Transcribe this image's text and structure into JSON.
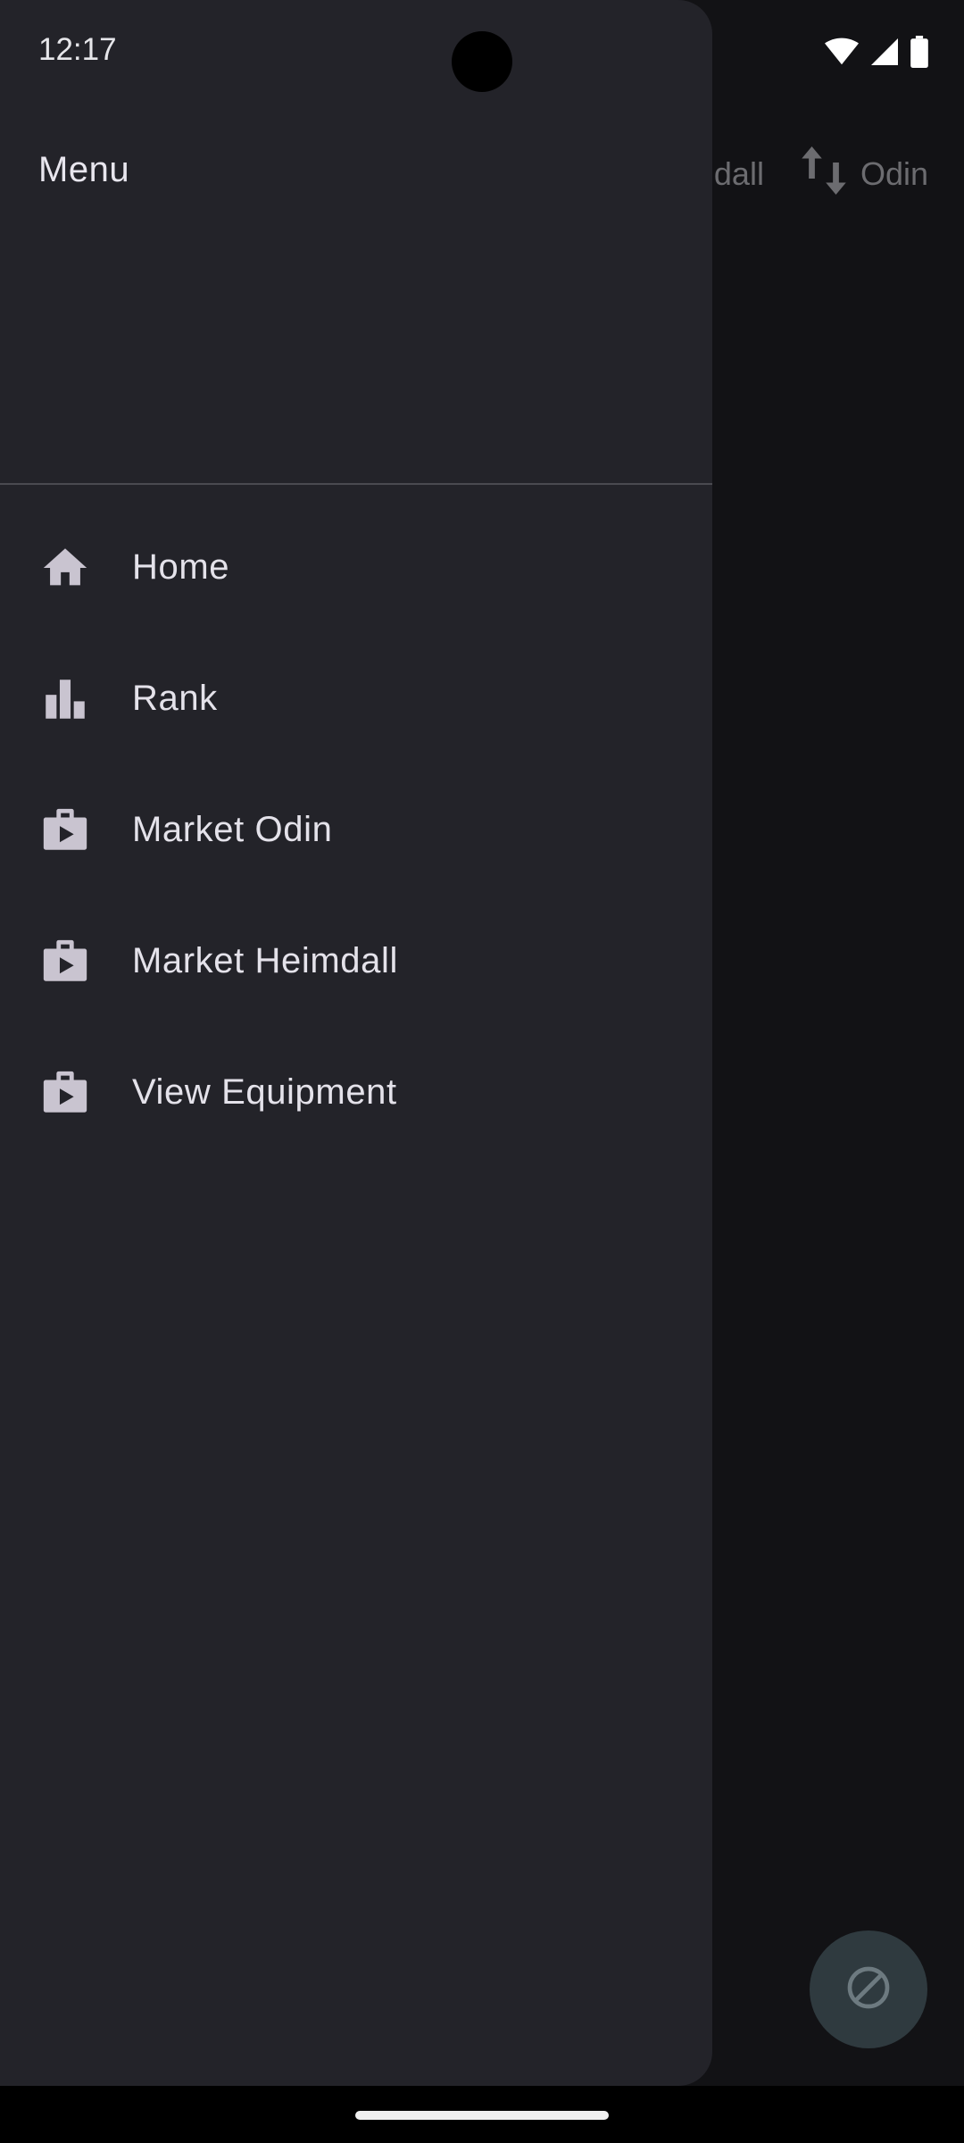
{
  "status_bar": {
    "time": "12:17",
    "icons": [
      "wifi-icon",
      "signal-icon",
      "battery-icon"
    ]
  },
  "background_app": {
    "toolbar": {
      "action_partial_label": "dall",
      "swap_label": "Odin"
    },
    "fab_icon": "block-icon"
  },
  "drawer": {
    "title": "Menu",
    "items": [
      {
        "label": "Home",
        "icon": "home-icon"
      },
      {
        "label": "Rank",
        "icon": "bar-chart-icon"
      },
      {
        "label": "Market Odin",
        "icon": "shop-icon"
      },
      {
        "label": "Market Heimdall",
        "icon": "shop-icon"
      },
      {
        "label": "View Equipment",
        "icon": "shop-icon"
      }
    ]
  },
  "colors": {
    "drawer_bg": "#232329",
    "icon": "#c9c4d0",
    "text": "#e4e2ea"
  }
}
